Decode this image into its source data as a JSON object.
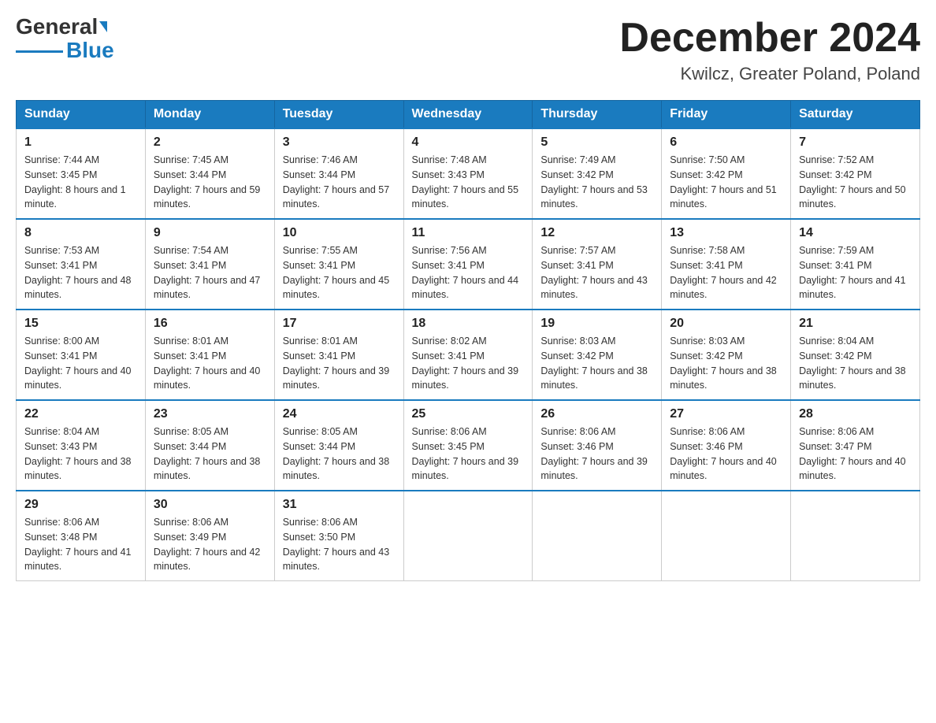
{
  "header": {
    "logo_text_black": "General",
    "logo_text_blue": "Blue",
    "month_title": "December 2024",
    "location": "Kwilcz, Greater Poland, Poland"
  },
  "days_of_week": [
    "Sunday",
    "Monday",
    "Tuesday",
    "Wednesday",
    "Thursday",
    "Friday",
    "Saturday"
  ],
  "weeks": [
    [
      {
        "day": "1",
        "sunrise": "7:44 AM",
        "sunset": "3:45 PM",
        "daylight": "8 hours and 1 minute."
      },
      {
        "day": "2",
        "sunrise": "7:45 AM",
        "sunset": "3:44 PM",
        "daylight": "7 hours and 59 minutes."
      },
      {
        "day": "3",
        "sunrise": "7:46 AM",
        "sunset": "3:44 PM",
        "daylight": "7 hours and 57 minutes."
      },
      {
        "day": "4",
        "sunrise": "7:48 AM",
        "sunset": "3:43 PM",
        "daylight": "7 hours and 55 minutes."
      },
      {
        "day": "5",
        "sunrise": "7:49 AM",
        "sunset": "3:42 PM",
        "daylight": "7 hours and 53 minutes."
      },
      {
        "day": "6",
        "sunrise": "7:50 AM",
        "sunset": "3:42 PM",
        "daylight": "7 hours and 51 minutes."
      },
      {
        "day": "7",
        "sunrise": "7:52 AM",
        "sunset": "3:42 PM",
        "daylight": "7 hours and 50 minutes."
      }
    ],
    [
      {
        "day": "8",
        "sunrise": "7:53 AM",
        "sunset": "3:41 PM",
        "daylight": "7 hours and 48 minutes."
      },
      {
        "day": "9",
        "sunrise": "7:54 AM",
        "sunset": "3:41 PM",
        "daylight": "7 hours and 47 minutes."
      },
      {
        "day": "10",
        "sunrise": "7:55 AM",
        "sunset": "3:41 PM",
        "daylight": "7 hours and 45 minutes."
      },
      {
        "day": "11",
        "sunrise": "7:56 AM",
        "sunset": "3:41 PM",
        "daylight": "7 hours and 44 minutes."
      },
      {
        "day": "12",
        "sunrise": "7:57 AM",
        "sunset": "3:41 PM",
        "daylight": "7 hours and 43 minutes."
      },
      {
        "day": "13",
        "sunrise": "7:58 AM",
        "sunset": "3:41 PM",
        "daylight": "7 hours and 42 minutes."
      },
      {
        "day": "14",
        "sunrise": "7:59 AM",
        "sunset": "3:41 PM",
        "daylight": "7 hours and 41 minutes."
      }
    ],
    [
      {
        "day": "15",
        "sunrise": "8:00 AM",
        "sunset": "3:41 PM",
        "daylight": "7 hours and 40 minutes."
      },
      {
        "day": "16",
        "sunrise": "8:01 AM",
        "sunset": "3:41 PM",
        "daylight": "7 hours and 40 minutes."
      },
      {
        "day": "17",
        "sunrise": "8:01 AM",
        "sunset": "3:41 PM",
        "daylight": "7 hours and 39 minutes."
      },
      {
        "day": "18",
        "sunrise": "8:02 AM",
        "sunset": "3:41 PM",
        "daylight": "7 hours and 39 minutes."
      },
      {
        "day": "19",
        "sunrise": "8:03 AM",
        "sunset": "3:42 PM",
        "daylight": "7 hours and 38 minutes."
      },
      {
        "day": "20",
        "sunrise": "8:03 AM",
        "sunset": "3:42 PM",
        "daylight": "7 hours and 38 minutes."
      },
      {
        "day": "21",
        "sunrise": "8:04 AM",
        "sunset": "3:42 PM",
        "daylight": "7 hours and 38 minutes."
      }
    ],
    [
      {
        "day": "22",
        "sunrise": "8:04 AM",
        "sunset": "3:43 PM",
        "daylight": "7 hours and 38 minutes."
      },
      {
        "day": "23",
        "sunrise": "8:05 AM",
        "sunset": "3:44 PM",
        "daylight": "7 hours and 38 minutes."
      },
      {
        "day": "24",
        "sunrise": "8:05 AM",
        "sunset": "3:44 PM",
        "daylight": "7 hours and 38 minutes."
      },
      {
        "day": "25",
        "sunrise": "8:06 AM",
        "sunset": "3:45 PM",
        "daylight": "7 hours and 39 minutes."
      },
      {
        "day": "26",
        "sunrise": "8:06 AM",
        "sunset": "3:46 PM",
        "daylight": "7 hours and 39 minutes."
      },
      {
        "day": "27",
        "sunrise": "8:06 AM",
        "sunset": "3:46 PM",
        "daylight": "7 hours and 40 minutes."
      },
      {
        "day": "28",
        "sunrise": "8:06 AM",
        "sunset": "3:47 PM",
        "daylight": "7 hours and 40 minutes."
      }
    ],
    [
      {
        "day": "29",
        "sunrise": "8:06 AM",
        "sunset": "3:48 PM",
        "daylight": "7 hours and 41 minutes."
      },
      {
        "day": "30",
        "sunrise": "8:06 AM",
        "sunset": "3:49 PM",
        "daylight": "7 hours and 42 minutes."
      },
      {
        "day": "31",
        "sunrise": "8:06 AM",
        "sunset": "3:50 PM",
        "daylight": "7 hours and 43 minutes."
      },
      null,
      null,
      null,
      null
    ]
  ],
  "labels": {
    "sunrise": "Sunrise:",
    "sunset": "Sunset:",
    "daylight": "Daylight:"
  }
}
